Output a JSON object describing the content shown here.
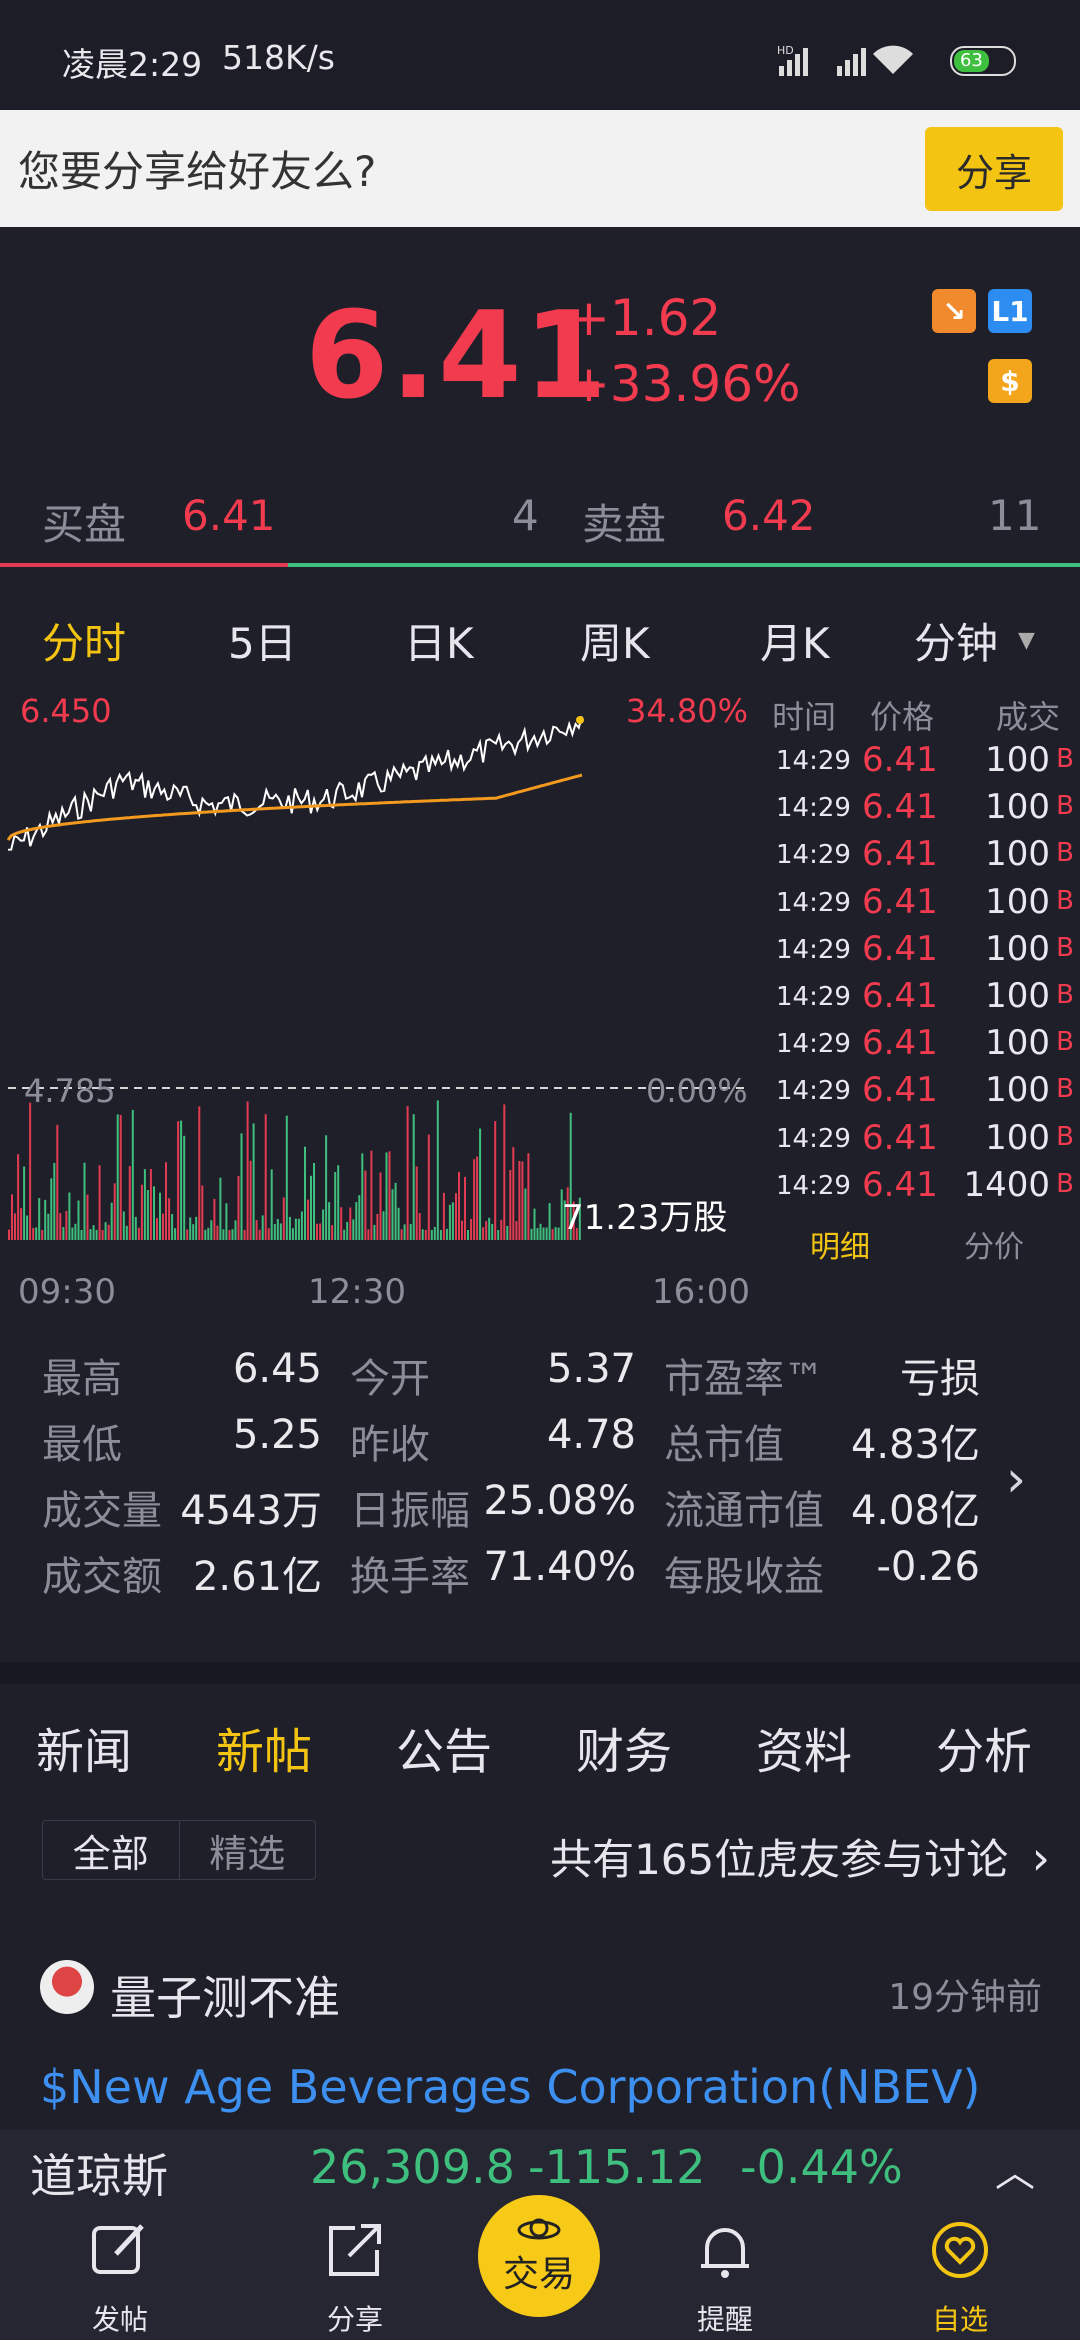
{
  "status_bar": {
    "time": "凌晨2:29",
    "speed": "518K/s",
    "battery": "63"
  },
  "share_bar": {
    "prompt": "您要分享给好友么?",
    "button": "分享"
  },
  "quote": {
    "price": "6.41",
    "change": "+1.62",
    "change_pct": "+33.96%",
    "badge_l1": "L1",
    "badge_dollar": "$"
  },
  "bid_ask": {
    "bid_label": "买盘",
    "bid_price": "6.41",
    "bid_size": "4",
    "ask_label": "卖盘",
    "ask_price": "6.42",
    "ask_size": "11"
  },
  "chart_tabs": [
    "分时",
    "5日",
    "日K",
    "周K",
    "月K",
    "分钟"
  ],
  "chart": {
    "high_label": "6.450",
    "high_pct": "34.80%",
    "ref_label": "4.785",
    "ref_pct": "0.00%",
    "volume_label": "71.23万股",
    "time_axis": [
      "09:30",
      "12:30",
      "16:00"
    ]
  },
  "trades": {
    "headers": [
      "时间",
      "价格",
      "成交"
    ],
    "rows": [
      {
        "time": "14:29",
        "price": "6.41",
        "vol": "100",
        "side": "B"
      },
      {
        "time": "14:29",
        "price": "6.41",
        "vol": "100",
        "side": "B"
      },
      {
        "time": "14:29",
        "price": "6.41",
        "vol": "100",
        "side": "B"
      },
      {
        "time": "14:29",
        "price": "6.41",
        "vol": "100",
        "side": "B"
      },
      {
        "time": "14:29",
        "price": "6.41",
        "vol": "100",
        "side": "B"
      },
      {
        "time": "14:29",
        "price": "6.41",
        "vol": "100",
        "side": "B"
      },
      {
        "time": "14:29",
        "price": "6.41",
        "vol": "100",
        "side": "B"
      },
      {
        "time": "14:29",
        "price": "6.41",
        "vol": "100",
        "side": "B"
      },
      {
        "time": "14:29",
        "price": "6.41",
        "vol": "100",
        "side": "B"
      },
      {
        "time": "14:29",
        "price": "6.41",
        "vol": "1400",
        "side": "B"
      }
    ],
    "tab_detail": "明细",
    "tab_price": "分价"
  },
  "stats": [
    [
      {
        "l": "最高",
        "v": "6.45"
      },
      {
        "l": "今开",
        "v": "5.37"
      },
      {
        "l": "市盈率™",
        "v": "亏损"
      }
    ],
    [
      {
        "l": "最低",
        "v": "5.25"
      },
      {
        "l": "昨收",
        "v": "4.78"
      },
      {
        "l": "总市值",
        "v": "4.83亿"
      }
    ],
    [
      {
        "l": "成交量",
        "v": "4543万"
      },
      {
        "l": "日振幅",
        "v": "25.08%"
      },
      {
        "l": "流通市值",
        "v": "4.08亿"
      }
    ],
    [
      {
        "l": "成交额",
        "v": "2.61亿"
      },
      {
        "l": "换手率",
        "v": "71.40%"
      },
      {
        "l": "每股收益",
        "v": "-0.26"
      }
    ]
  ],
  "news_tabs": [
    "新闻",
    "新帖",
    "公告",
    "财务",
    "资料",
    "分析"
  ],
  "filter": {
    "all": "全部",
    "featured": "精选",
    "discussion": "共有165位虎友参与讨论"
  },
  "post": {
    "user": "量子测不准",
    "time": "19分钟前",
    "title": "$New Age Beverages Corporation(NBEV)"
  },
  "ticker": {
    "name": "道琼斯",
    "value": "26,309.8",
    "change": "-115.12",
    "pct": "-0.44%"
  },
  "bottom_nav": {
    "post": "发帖",
    "share": "分享",
    "trade": "交易",
    "alert": "提醒",
    "watch": "自选"
  },
  "colors": {
    "up": "#f23b4f",
    "down": "#3fbf7e",
    "accent": "#f3c512",
    "link": "#3d8ff0"
  }
}
